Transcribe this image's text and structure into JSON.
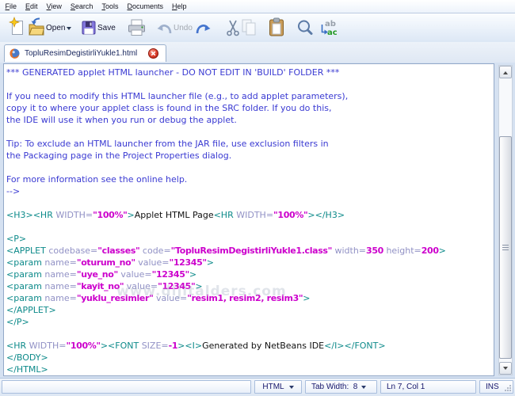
{
  "menu": {
    "items": [
      {
        "label": "File"
      },
      {
        "label": "Edit"
      },
      {
        "label": "View"
      },
      {
        "label": "Search"
      },
      {
        "label": "Tools"
      },
      {
        "label": "Documents"
      },
      {
        "label": "Help"
      }
    ]
  },
  "toolbar": {
    "open_label": "Open",
    "save_label": "Save",
    "undo_label": "Undo"
  },
  "tab": {
    "title": "TopluResimDegistirliYukle1.html"
  },
  "editor": {
    "lines": [
      {
        "t": [
          [
            "c",
            "*** GENERATED applet HTML launcher - DO NOT EDIT IN 'BUILD' FOLDER ***"
          ]
        ]
      },
      {
        "t": []
      },
      {
        "t": [
          [
            "c",
            "If you need to modify this HTML launcher file (e.g., to add applet parameters),"
          ]
        ]
      },
      {
        "t": [
          [
            "c",
            "copy it to where your applet class is found in the SRC folder. If you do this,"
          ]
        ]
      },
      {
        "t": [
          [
            "c",
            "the IDE will use it when you run or debug the applet."
          ]
        ]
      },
      {
        "t": []
      },
      {
        "t": [
          [
            "c",
            "Tip: To exclude an HTML launcher from the JAR file, use exclusion filters in"
          ]
        ]
      },
      {
        "t": [
          [
            "c",
            "the Packaging page in the Project Properties dialog."
          ]
        ]
      },
      {
        "t": []
      },
      {
        "t": [
          [
            "c",
            "For more information see the online help."
          ]
        ]
      },
      {
        "t": [
          [
            "c",
            "-->"
          ]
        ]
      },
      {
        "t": []
      },
      {
        "t": [
          [
            "t",
            "<H3><HR "
          ],
          [
            "a",
            "WIDTH="
          ],
          [
            "v",
            "\"100%\""
          ],
          [
            "t",
            ">"
          ],
          [
            "p",
            "Applet HTML Page"
          ],
          [
            "t",
            "<HR "
          ],
          [
            "a",
            "WIDTH="
          ],
          [
            "v",
            "\"100%\""
          ],
          [
            "t",
            "></H3>"
          ]
        ]
      },
      {
        "t": []
      },
      {
        "t": [
          [
            "t",
            "<P>"
          ]
        ]
      },
      {
        "t": [
          [
            "t",
            "<APPLET "
          ],
          [
            "a",
            "codebase="
          ],
          [
            "v",
            "\"classes\""
          ],
          [
            "t",
            " "
          ],
          [
            "a",
            "code="
          ],
          [
            "v",
            "\"TopluResimDegistirliYukle1.class\""
          ],
          [
            "t",
            " "
          ],
          [
            "a",
            "width="
          ],
          [
            "v",
            "350"
          ],
          [
            "t",
            " "
          ],
          [
            "a",
            "height="
          ],
          [
            "v",
            "200"
          ],
          [
            "t",
            ">"
          ]
        ]
      },
      {
        "t": [
          [
            "t",
            "<param "
          ],
          [
            "a",
            "name="
          ],
          [
            "v",
            "\"oturum_no\""
          ],
          [
            "t",
            " "
          ],
          [
            "a",
            "value="
          ],
          [
            "v",
            "\"12345\""
          ],
          [
            "t",
            ">"
          ]
        ]
      },
      {
        "t": [
          [
            "t",
            "<param "
          ],
          [
            "a",
            "name="
          ],
          [
            "v",
            "\"uye_no\""
          ],
          [
            "t",
            " "
          ],
          [
            "a",
            "value="
          ],
          [
            "v",
            "\"12345\""
          ],
          [
            "t",
            ">"
          ]
        ]
      },
      {
        "t": [
          [
            "t",
            "<param "
          ],
          [
            "a",
            "name="
          ],
          [
            "v",
            "\"kayit_no\""
          ],
          [
            "t",
            " "
          ],
          [
            "a",
            "value="
          ],
          [
            "v",
            "\"12345\""
          ],
          [
            "t",
            ">"
          ]
        ]
      },
      {
        "t": [
          [
            "t",
            "<param "
          ],
          [
            "a",
            "name="
          ],
          [
            "v",
            "\"yuklu_resimler\""
          ],
          [
            "t",
            " "
          ],
          [
            "a",
            "value="
          ],
          [
            "v",
            "\"resim1, resim2, resim3\""
          ],
          [
            "t",
            ">"
          ]
        ]
      },
      {
        "t": [
          [
            "t",
            "</APPLET>"
          ]
        ]
      },
      {
        "t": [
          [
            "t",
            "</P>"
          ]
        ]
      },
      {
        "t": []
      },
      {
        "t": [
          [
            "t",
            "<HR "
          ],
          [
            "a",
            "WIDTH="
          ],
          [
            "v",
            "\"100%\""
          ],
          [
            "t",
            "><FONT "
          ],
          [
            "a",
            "SIZE="
          ],
          [
            "v",
            "-1"
          ],
          [
            "t",
            "><I>"
          ],
          [
            "p",
            "Generated by NetBeans IDE"
          ],
          [
            "t",
            "</I></FONT>"
          ]
        ]
      },
      {
        "t": [
          [
            "t",
            "</BODY>"
          ]
        ]
      },
      {
        "t": [
          [
            "t",
            "</HTML>"
          ]
        ]
      }
    ],
    "syntax_colors": {
      "comment": "#3a3ad2",
      "tag": "#0d8a8a",
      "attribute": "#9191c5",
      "value": "#cc00cc",
      "text": "#111111"
    }
  },
  "watermark": {
    "text": "www.dijitalders.com"
  },
  "statusbar": {
    "mode": "HTML",
    "tab_width": "Tab Width:  8",
    "position": "Ln 7, Col 1",
    "insert_mode": "INS"
  }
}
